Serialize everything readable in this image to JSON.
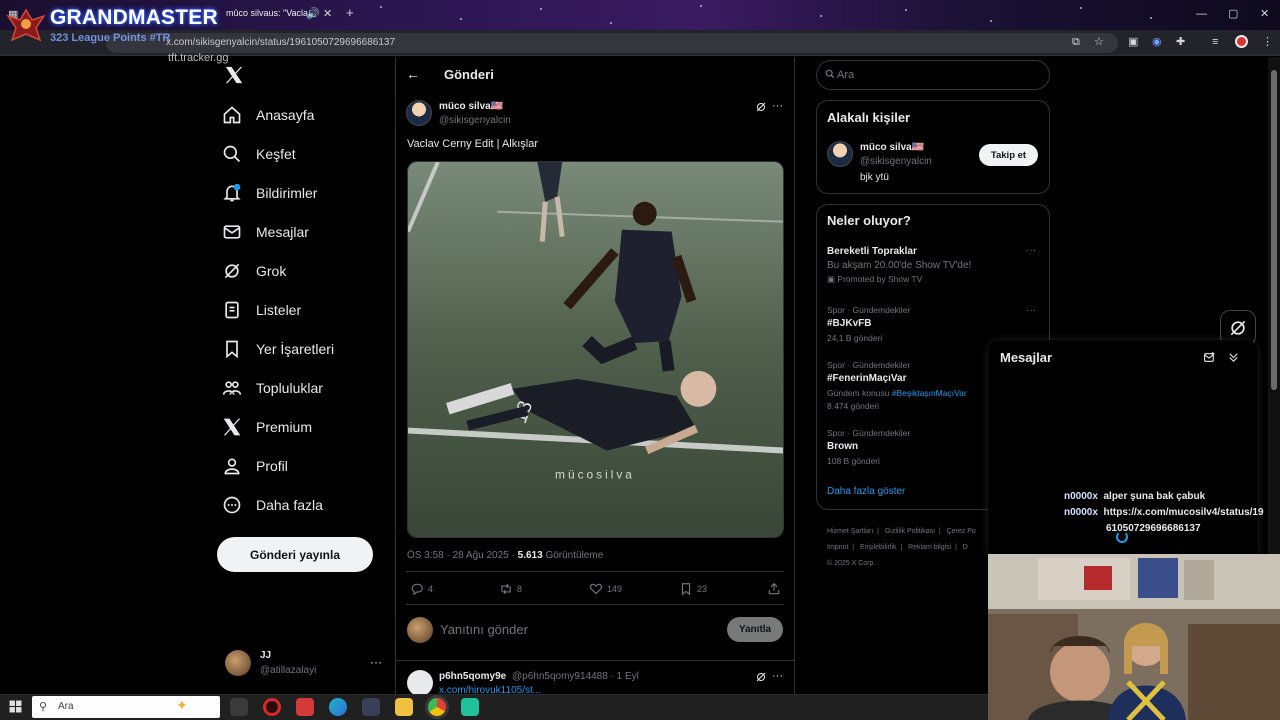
{
  "browser": {
    "tab_title": "mûco silvaus: \"Vacla",
    "url": "x.com/sikisgenyalcin/status/1961050729696686137"
  },
  "overlay": {
    "title": "GRANDMASTER",
    "subtitle": "323 League Points #TR",
    "tracker": "tft.tracker.gg"
  },
  "nav": {
    "items": [
      "Anasayfa",
      "Keşfet",
      "Bildirimler",
      "Mesajlar",
      "Grok",
      "Listeler",
      "Yer İşaretleri",
      "Topluluklar",
      "Premium",
      "Profil",
      "Daha fazla"
    ],
    "post_button": "Gönderi yayınla",
    "account_name": "JJ",
    "account_handle": "@atillazalayi"
  },
  "post": {
    "header": "Gönderi",
    "author_name": "müco silva🇺🇸",
    "author_handle": "@sikisgenyalcin",
    "text": "Vaclav Cerny Edit | Alkışlar",
    "watermark": "mücosilva",
    "timestamp": "ÖS 3:58 · 28 Ağu 2025 · ",
    "views_count": "5.613",
    "views_label": " Görüntüleme",
    "replies": "4",
    "reposts": "8",
    "likes": "149",
    "bookmarks": "23",
    "reply_placeholder": "Yanıtını gönder",
    "reply_button": "Yanıtla"
  },
  "reply": {
    "name": "p6hn5qomy9e",
    "handle_time": "@p6hn5qomy914488 · 1 Eyl",
    "link": "x.com/hirovuk1105/st..."
  },
  "right": {
    "search_placeholder": "Ara",
    "relevant_title": "Alakalı kişiler",
    "person_name": "müco silva🇺🇸",
    "person_handle": "@sikisgenyalcin",
    "person_bio": "bjk ytü",
    "follow_button": "Takip et",
    "trends_title": "Neler oluyor?",
    "trends": [
      {
        "meta": "",
        "title": "Bereketli Topraklar",
        "sub": "Bu akşam 20.00'de Show TV'de!",
        "extra": "Promoted by Show TV"
      },
      {
        "meta": "Spor · Gündemdekiler",
        "title": "#BJKvFB",
        "sub": "24,1 B gönderi",
        "extra": ""
      },
      {
        "meta": "Spor · Gündemdekiler",
        "title": "#FenerinMaçıVar",
        "sub": "Gündem konusu ",
        "link": "#BeşiktaşınMaçıVar",
        "extra": "8.474 gönderi"
      },
      {
        "meta": "Spor · Gündemdekiler",
        "title": "Brown",
        "sub": "108 B gönderi",
        "extra": ""
      }
    ],
    "show_more": "Daha fazla göster",
    "footer": [
      "Hizmet Şartları",
      "Gizlilik Politikası",
      "Çerez Po",
      "Imprint",
      "Erişilebilirlik",
      "Reklam bilgisi",
      "D",
      "© 2025 X Corp."
    ]
  },
  "dm": {
    "title": "Mesajlar",
    "messages": [
      {
        "user": "n0000x",
        "text": "alper şuna bak çabuk"
      },
      {
        "user": "n0000x",
        "text": "https://x.com/mucosilv4/status/19"
      },
      {
        "user": "",
        "text": "61050729696686137"
      }
    ]
  },
  "taskbar": {
    "search_placeholder": "Ara"
  }
}
